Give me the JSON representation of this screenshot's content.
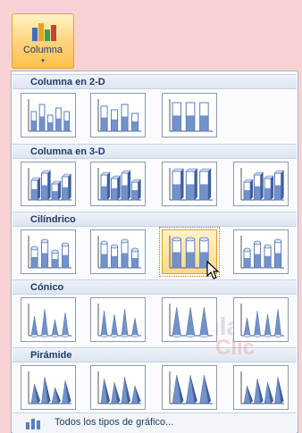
{
  "ribbon_button": {
    "label": "Columna",
    "arrow": "▾"
  },
  "sections": [
    {
      "title": "Columna en 2-D",
      "items": [
        "Columna agrupada",
        "Columna apilada",
        "Columna 100% apilada"
      ]
    },
    {
      "title": "Columna en 3-D",
      "items": [
        "Columna agrupada 3-D",
        "Columna apilada 3-D",
        "Columna 100% apilada 3-D",
        "Columna 3-D"
      ]
    },
    {
      "title": "Cilíndrico",
      "items": [
        "Cilindro agrupado",
        "Cilindro apilado",
        "Cilindro 100% apilado",
        "Cilindro 3-D"
      ]
    },
    {
      "title": "Cónico",
      "items": [
        "Cono agrupado",
        "Cono apilado",
        "Cono 100% apilado",
        "Cono 3-D"
      ]
    },
    {
      "title": "Pirámide",
      "items": [
        "Pirámide agrupada",
        "Pirámide apilada",
        "Pirámide 100% apilada",
        "Pirámide 3-D"
      ]
    }
  ],
  "selected_item": "Cilindro 100% apilado",
  "footer": {
    "label": "Todos los tipos de gráfico..."
  },
  "watermark": {
    "line1": "aula",
    "line2": "Clic"
  },
  "colors": {
    "accent": "#e0a02a",
    "header_text": "#1f3b68",
    "chart_fill": "#5b7fc0"
  }
}
